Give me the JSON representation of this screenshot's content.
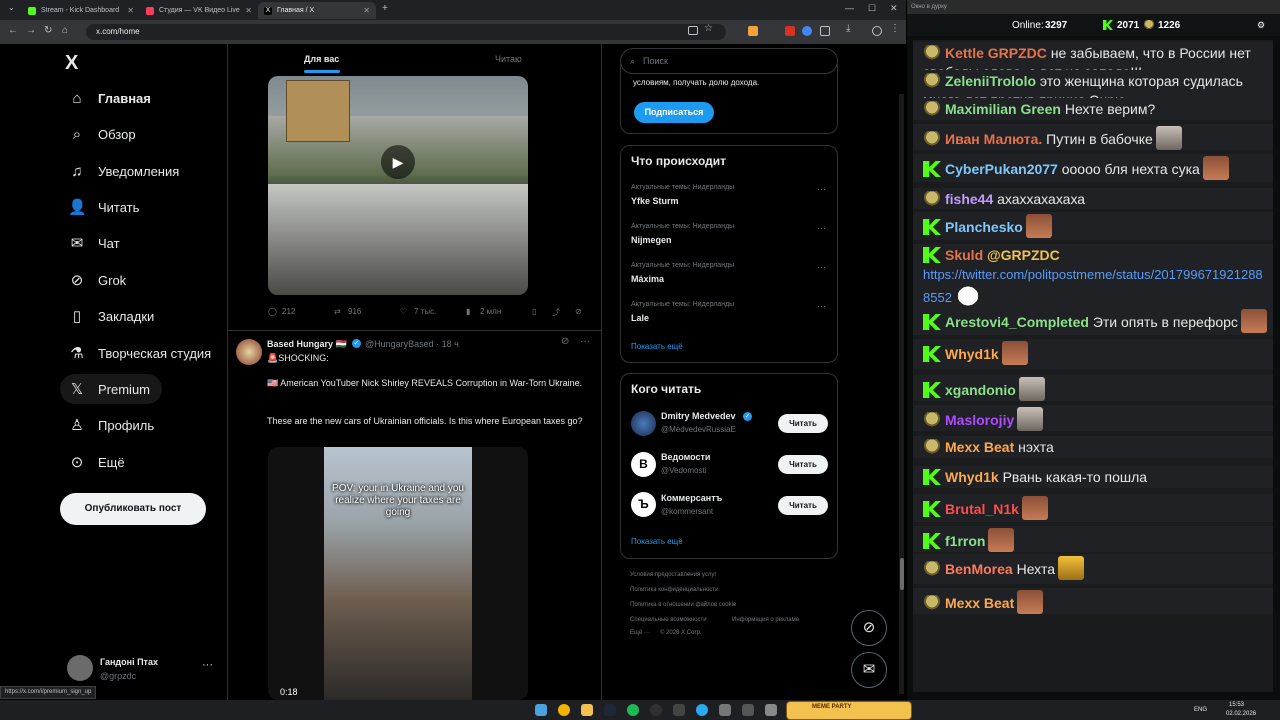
{
  "browser": {
    "tabs": [
      {
        "title": "Stream - Kick Dashboard",
        "fav_color": "#53fc18"
      },
      {
        "title": "Студия — VK Видео Live",
        "fav_color": "#ff3b5c"
      },
      {
        "title": "Главная / X",
        "fav_color": "#ffffff"
      }
    ],
    "new_tab": "+",
    "url": "x.com/home",
    "status_url": "https://x.com/i/premium_sign_up"
  },
  "nav": {
    "logo": "X",
    "items": [
      {
        "label": "Главная",
        "icon": "home-icon"
      },
      {
        "label": "Обзор",
        "icon": "search-icon"
      },
      {
        "label": "Уведомления",
        "icon": "bell-icon"
      },
      {
        "label": "Читать",
        "icon": "add-person-icon"
      },
      {
        "label": "Чат",
        "icon": "mail-icon"
      },
      {
        "label": "Grok",
        "icon": "grok-icon"
      },
      {
        "label": "Закладки",
        "icon": "bookmark-icon"
      },
      {
        "label": "Творческая студия",
        "icon": "flask-icon"
      },
      {
        "label": "Premium",
        "icon": "x-logo-icon"
      },
      {
        "label": "Профиль",
        "icon": "person-icon"
      },
      {
        "label": "Ещё",
        "icon": "more-circle-icon"
      }
    ],
    "post_button": "Опубликовать пост",
    "account_name": "Гандоні Птах",
    "account_handle": "@grpzdc",
    "account_more": "···"
  },
  "feed": {
    "tabs": [
      "Для вас",
      "Читаю"
    ],
    "tweet1_actions": {
      "replies": "212",
      "reposts": "916",
      "likes": "7 тыс.",
      "views": "2 млн"
    },
    "tweet2": {
      "name": "Based Hungary 🇭🇺",
      "handle": "@HungaryBased · 18 ч",
      "line1": "🚨SHOCKING:",
      "line2": "🇺🇸 American YouTuber Nick Shirley REVEALS Corruption in War-Torn Ukraine.",
      "line3": "These are the new cars of Ukrainian officials. Is this where European taxes go?",
      "video_caption": "POV: your in Ukraine and you realize where your taxes are going",
      "video_time": "0:18"
    }
  },
  "right": {
    "search_placeholder": "Поиск",
    "premium_text": "условиям, получать долю дохода.",
    "subscribe": "Подписаться",
    "trends_title": "Что происходит",
    "trends": [
      {
        "meta": "Актуальные темы: Нидерланды",
        "name": "Yfke Sturm"
      },
      {
        "meta": "Актуальные темы: Нидерланды",
        "name": "Nijmegen"
      },
      {
        "meta": "Актуальные темы: Нидерланды",
        "name": "Máxima"
      },
      {
        "meta": "Актуальные темы: Нидерланды",
        "name": "Lale"
      }
    ],
    "show_more": "Показать ещё",
    "who_title": "Кого читать",
    "who": [
      {
        "name": "Dmitry Medvedev",
        "handle": "@MedvedevRussiaE",
        "btn": "Читать"
      },
      {
        "name": "Ведомости",
        "handle": "@Vedomosti",
        "btn": "Читать"
      },
      {
        "name": "Коммерсантъ",
        "handle": "@kommersant",
        "btn": "Читать"
      }
    ],
    "footer": [
      "Условия предоставления услуг",
      "Политика конфиденциальности",
      "Политика в отношении файлов cookie",
      "Специальные возможности",
      "Информация о рекламе",
      "Ещё ···",
      "© 2026 X Corp."
    ]
  },
  "chat": {
    "window_title": "Окно в дурку",
    "online_label": "Online:",
    "online_count": "3297",
    "kick_count": "2071",
    "other_count": "1226",
    "messages": [
      {
        "badge": "p",
        "user": "Kettle",
        "user2": "GRPZDC",
        "color": "#e8734a",
        "text": "не забываем, что в России нет свободы слова, а вот на западе!!!"
      },
      {
        "badge": "p",
        "user": "ZeleniiTrololo",
        "color": "#8be08b",
        "text": "это женщина которая судилась много лет против принца Энрю"
      },
      {
        "badge": "p",
        "user": "Maximilian Green",
        "color": "#8be08b",
        "text": "Нехте верим?"
      },
      {
        "badge": "p",
        "user": "Иван Малюта.",
        "color": "#e8734a",
        "text": "Путин в бабочке",
        "emote": "face"
      },
      {
        "badge": "k",
        "user": "CyberPukan2077",
        "color": "#7ec8ff",
        "text": "ооооо бля нехта сука",
        "emote": "brown"
      },
      {
        "badge": "p",
        "user": "fishe44",
        "color": "#c49bff",
        "text": "ахаххахахаха"
      },
      {
        "badge": "k",
        "user": "Planchesko",
        "color": "#7ec8ff",
        "text": "",
        "emote": "brown"
      },
      {
        "badge": "k",
        "user": "Skuld",
        "user2": "@GRPZDC",
        "color": "#e8734a",
        "text": "",
        "link": "https://twitter.com/politpostmeme/status/2017996719212888552",
        "emote": "troll"
      },
      {
        "badge": "k",
        "user": "Arestovi4_Completed",
        "color": "#8be08b",
        "text": "Эти опять в перефорс",
        "emote": "brown"
      },
      {
        "badge": "k",
        "user": "Whyd1k",
        "color": "#ffa94d",
        "text": "",
        "emote": "brown"
      },
      {
        "badge": "k",
        "user": "xgandonio",
        "color": "#8be08b",
        "text": "",
        "emote": "face"
      },
      {
        "badge": "p",
        "user": "Maslorojiy",
        "color": "#b04cff",
        "text": "",
        "emote": "face"
      },
      {
        "badge": "p",
        "user": "Mexx Beat",
        "color": "#ffa94d",
        "text": "нэхта"
      },
      {
        "badge": "k",
        "user": "Whyd1k",
        "color": "#ffa94d",
        "text": "Рвань какая-то пошла"
      },
      {
        "badge": "k",
        "user": "Brutal_N1k",
        "color": "#ff4d4d",
        "text": "",
        "emote": "brown"
      },
      {
        "badge": "k",
        "user": "f1rron",
        "color": "#8be08b",
        "text": "",
        "emote": "brown"
      },
      {
        "badge": "p",
        "user": "BenMorea",
        "color": "#ff7a59",
        "text": "Нехта",
        "emote": "gold"
      },
      {
        "badge": "p",
        "user": "Mexx Beat",
        "color": "#ffa94d",
        "text": "",
        "emote": "brown"
      }
    ]
  },
  "taskbar": {
    "lang": "ENG",
    "time": "15:53",
    "date": "02.02.2026",
    "widget": "MEME PARTY"
  }
}
